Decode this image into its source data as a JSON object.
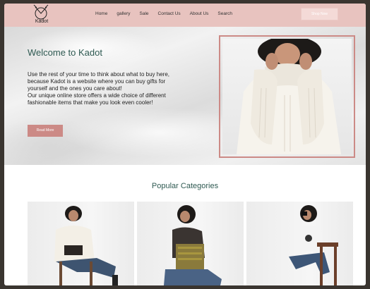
{
  "header": {
    "logo_text": "Kadot",
    "nav": [
      "Home",
      "gallery",
      "Sale",
      "Contact Us",
      "About Us",
      "Search"
    ],
    "shop_button": "Shop Now"
  },
  "hero": {
    "title": "Welcome to Kadot",
    "text_lines": [
      "Use the rest of your time to think about what to buy here,",
      "because Kadot is a website where you can buy gifts for",
      "yourself and the ones you care about!",
      "Our unique online store offers a wide choice of different",
      "fashionable items that make you look even cooler!"
    ],
    "button": "Read More"
  },
  "categories": {
    "title": "Popular Categories",
    "cards": [
      {
        "name": "white-sweater-model"
      },
      {
        "name": "black-top-model"
      },
      {
        "name": "white-tshirt-model"
      }
    ]
  },
  "colors": {
    "header_bg": "#e8c3bf",
    "accent": "#cc8a86",
    "heading": "#2f5a52"
  }
}
